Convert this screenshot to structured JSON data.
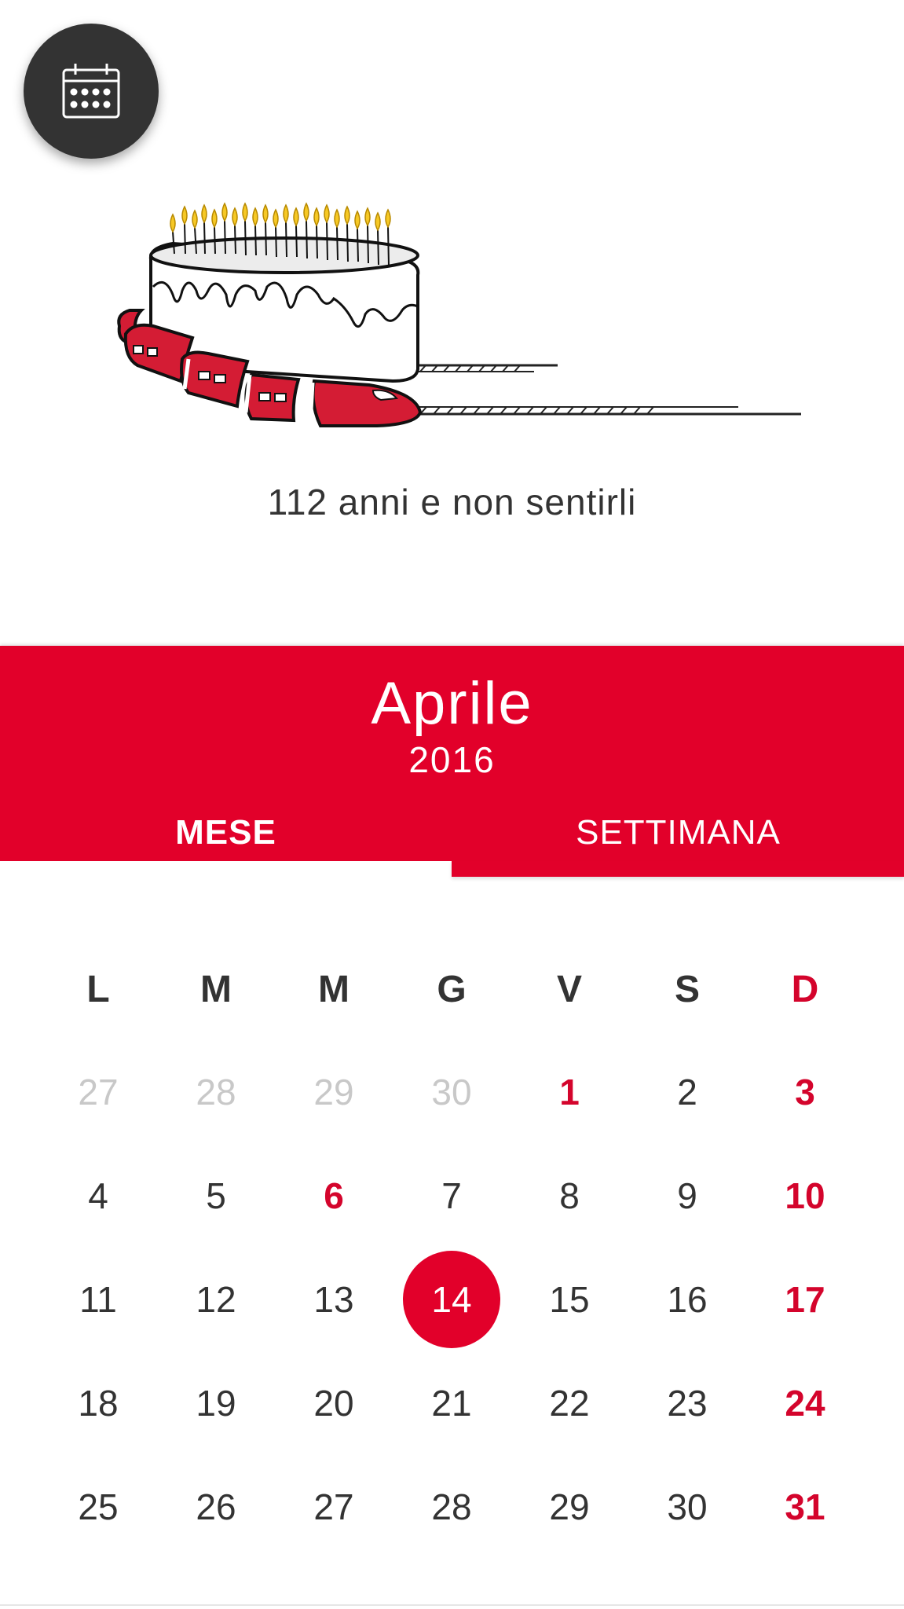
{
  "fab": {
    "icon": "calendar-icon"
  },
  "illustration": {
    "icon": "birthday-cake-train-illustration"
  },
  "caption": "112 anni e non sentirli",
  "calendar": {
    "month": "Aprile",
    "year": "2016",
    "tabs": [
      {
        "label": "MESE",
        "active": true
      },
      {
        "label": "SETTIMANA",
        "active": false
      }
    ],
    "weekdays": [
      "L",
      "M",
      "M",
      "G",
      "V",
      "S",
      "D"
    ],
    "weeks": [
      [
        {
          "d": "27",
          "t": "outside"
        },
        {
          "d": "28",
          "t": "outside"
        },
        {
          "d": "29",
          "t": "outside"
        },
        {
          "d": "30",
          "t": "outside"
        },
        {
          "d": "1",
          "t": "holiday"
        },
        {
          "d": "2",
          "t": "normal"
        },
        {
          "d": "3",
          "t": "holiday"
        }
      ],
      [
        {
          "d": "4",
          "t": "normal"
        },
        {
          "d": "5",
          "t": "normal"
        },
        {
          "d": "6",
          "t": "holiday"
        },
        {
          "d": "7",
          "t": "normal"
        },
        {
          "d": "8",
          "t": "normal"
        },
        {
          "d": "9",
          "t": "normal"
        },
        {
          "d": "10",
          "t": "holiday"
        }
      ],
      [
        {
          "d": "11",
          "t": "normal"
        },
        {
          "d": "12",
          "t": "normal"
        },
        {
          "d": "13",
          "t": "normal"
        },
        {
          "d": "14",
          "t": "today"
        },
        {
          "d": "15",
          "t": "normal"
        },
        {
          "d": "16",
          "t": "normal"
        },
        {
          "d": "17",
          "t": "holiday"
        }
      ],
      [
        {
          "d": "18",
          "t": "normal"
        },
        {
          "d": "19",
          "t": "normal"
        },
        {
          "d": "20",
          "t": "normal"
        },
        {
          "d": "21",
          "t": "normal"
        },
        {
          "d": "22",
          "t": "normal"
        },
        {
          "d": "23",
          "t": "normal"
        },
        {
          "d": "24",
          "t": "holiday"
        }
      ],
      [
        {
          "d": "25",
          "t": "normal"
        },
        {
          "d": "26",
          "t": "normal"
        },
        {
          "d": "27",
          "t": "normal"
        },
        {
          "d": "28",
          "t": "normal"
        },
        {
          "d": "29",
          "t": "normal"
        },
        {
          "d": "30",
          "t": "normal"
        },
        {
          "d": "31",
          "t": "holiday"
        }
      ]
    ]
  },
  "colors": {
    "accent": "#e2002a",
    "holiday": "#d4042c",
    "fab": "#333333",
    "text": "#333333",
    "muted": "#c8c8c8"
  }
}
